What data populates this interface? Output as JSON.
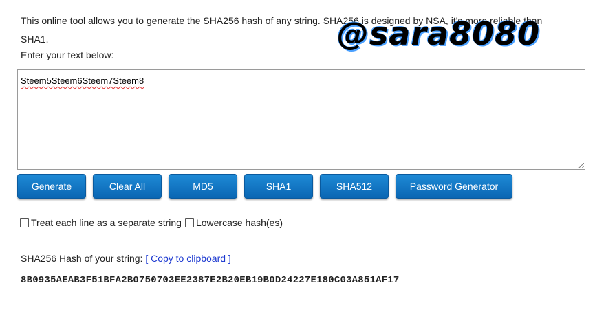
{
  "intro": {
    "text": "This online tool allows you to generate the SHA256 hash of any string. SHA256 is designed by NSA, it's more reliable than SHA1.",
    "enter_label": "Enter your text below:"
  },
  "watermark": "@sara8080",
  "input": {
    "value": "Steem5Steem6Steem7Steem8"
  },
  "buttons": {
    "generate": "Generate",
    "clear_all": "Clear All",
    "md5": "MD5",
    "sha1": "SHA1",
    "sha512": "SHA512",
    "password_generator": "Password Generator"
  },
  "options": {
    "separate_lines": "Treat each line as a separate string",
    "lowercase": "Lowercase hash(es)"
  },
  "result": {
    "label": "SHA256 Hash of your string:",
    "copy_link": "[ Copy to clipboard ]",
    "hash": "8B0935AEAB3F51BFA2B0750703EE2387E2B20EB19B0D24227E180C03A851AF17"
  },
  "colors": {
    "button": "#0a75c4",
    "link": "#1a37d0"
  }
}
